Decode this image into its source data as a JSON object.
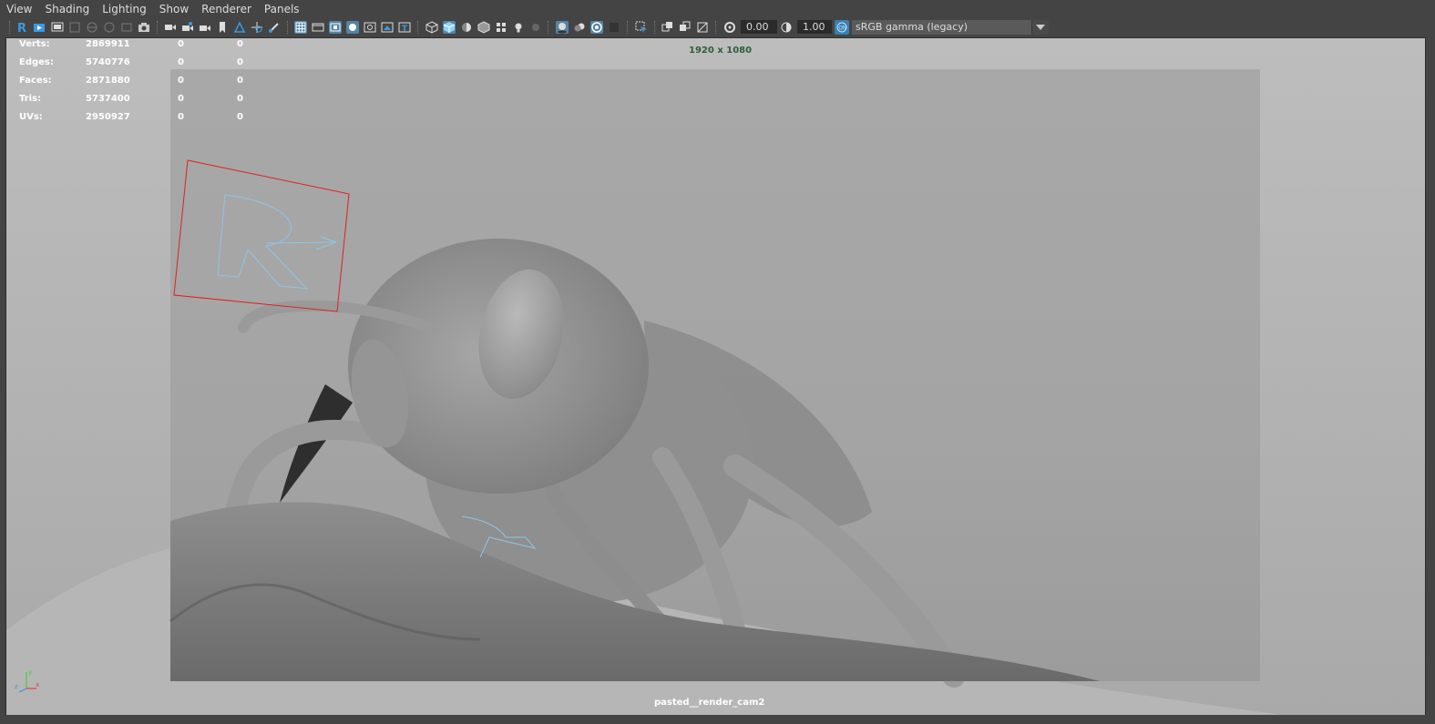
{
  "menu": [
    "View",
    "Shading",
    "Lighting",
    "Show",
    "Renderer",
    "Panels"
  ],
  "toolbar": {
    "exposure_value": "0.00",
    "gamma_value": "1.00",
    "color_space": "sRGB gamma (legacy)"
  },
  "hud": {
    "rows": [
      {
        "label": "Verts:",
        "total": "2869911",
        "selected": "0",
        "third": "0"
      },
      {
        "label": "Edges:",
        "total": "5740776",
        "selected": "0",
        "third": "0"
      },
      {
        "label": "Faces:",
        "total": "2871880",
        "selected": "0",
        "third": "0"
      },
      {
        "label": "Tris:",
        "total": "5737400",
        "selected": "0",
        "third": "0"
      },
      {
        "label": "UVs:",
        "total": "2950927",
        "selected": "0",
        "third": "0"
      }
    ]
  },
  "viewport": {
    "resolution": "1920 x 1080",
    "camera": "pasted__render_cam2",
    "axis_labels": {
      "y": "y",
      "z": "z",
      "x": "x"
    }
  },
  "colors": {
    "accent": "#5285a6",
    "bg": "#444444",
    "hud_text": "#ffffff",
    "resolution_text": "#2e5e3a"
  }
}
